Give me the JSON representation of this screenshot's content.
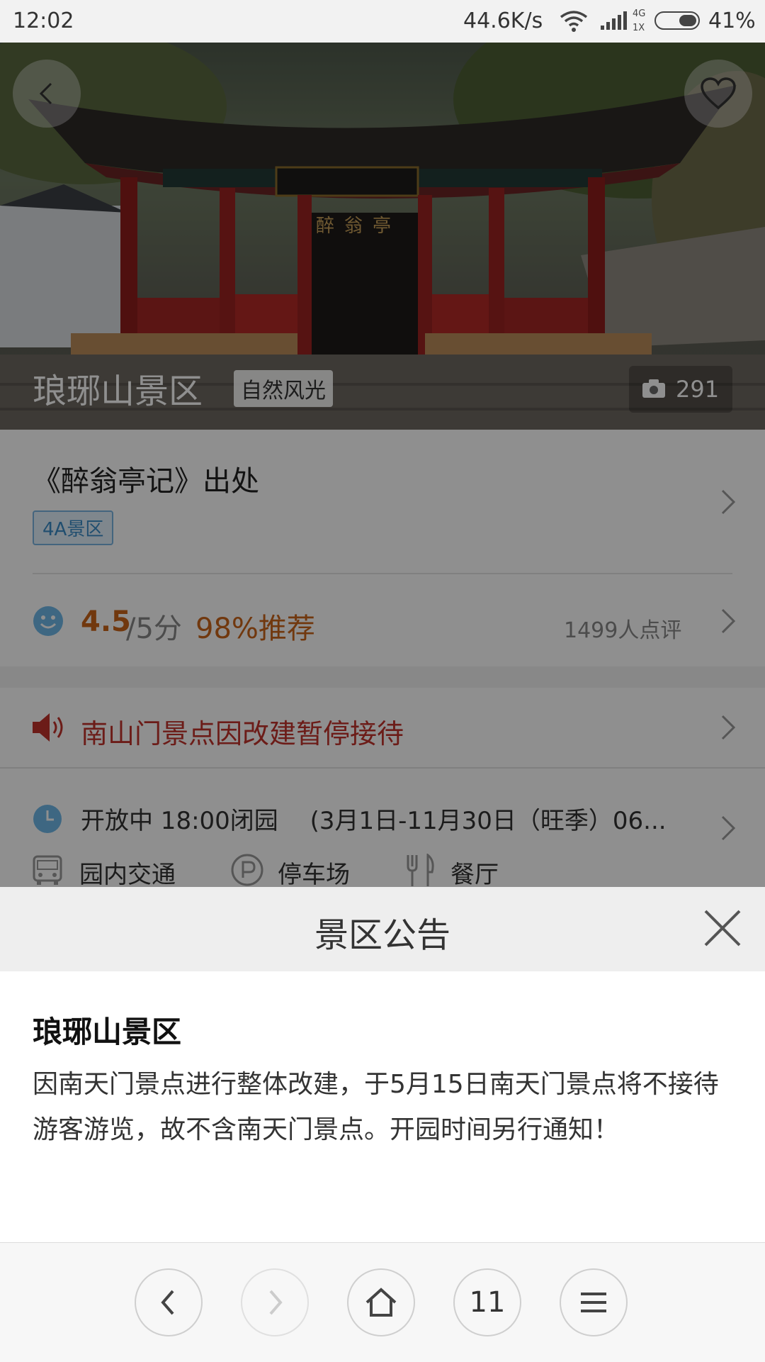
{
  "status_bar": {
    "time": "12:02",
    "net_speed": "44.6K/s",
    "net_type": "4G",
    "net_sub": "1X",
    "battery": "41%"
  },
  "hero": {
    "title": "琅琊山景区",
    "tag": "自然风光",
    "photo_count": "291",
    "sign_text": "醉翁亭"
  },
  "info": {
    "subtitle": "《醉翁亭记》出处",
    "level_badge": "4A景区",
    "rating_score": "4.5",
    "rating_total": "/5分",
    "recommend": "98%推荐",
    "review_count": "1499人点评"
  },
  "notice": {
    "text": "南山门景点因改建暂停接待"
  },
  "hours": {
    "text": "开放中 18:00闭园　 (3月1日-11月30日（旺季）06..."
  },
  "facilities": [
    {
      "label": "园内交通",
      "icon": "bus-icon"
    },
    {
      "label": "停车场",
      "icon": "parking-icon"
    },
    {
      "label": "餐厅",
      "icon": "restaurant-icon"
    }
  ],
  "announcement": {
    "header": "景区公告",
    "title": "琅琊山景区",
    "body": "因南天门景点进行整体改建，于5月15日南天门景点将不接待游客游览，故不含南天门景点。开园时间另行通知！"
  },
  "bottom_nav": {
    "tab_count": "11"
  },
  "colors": {
    "accent_orange": "#c9641a",
    "notice_red": "#c0332b",
    "badge_blue": "#3a8bc7"
  }
}
